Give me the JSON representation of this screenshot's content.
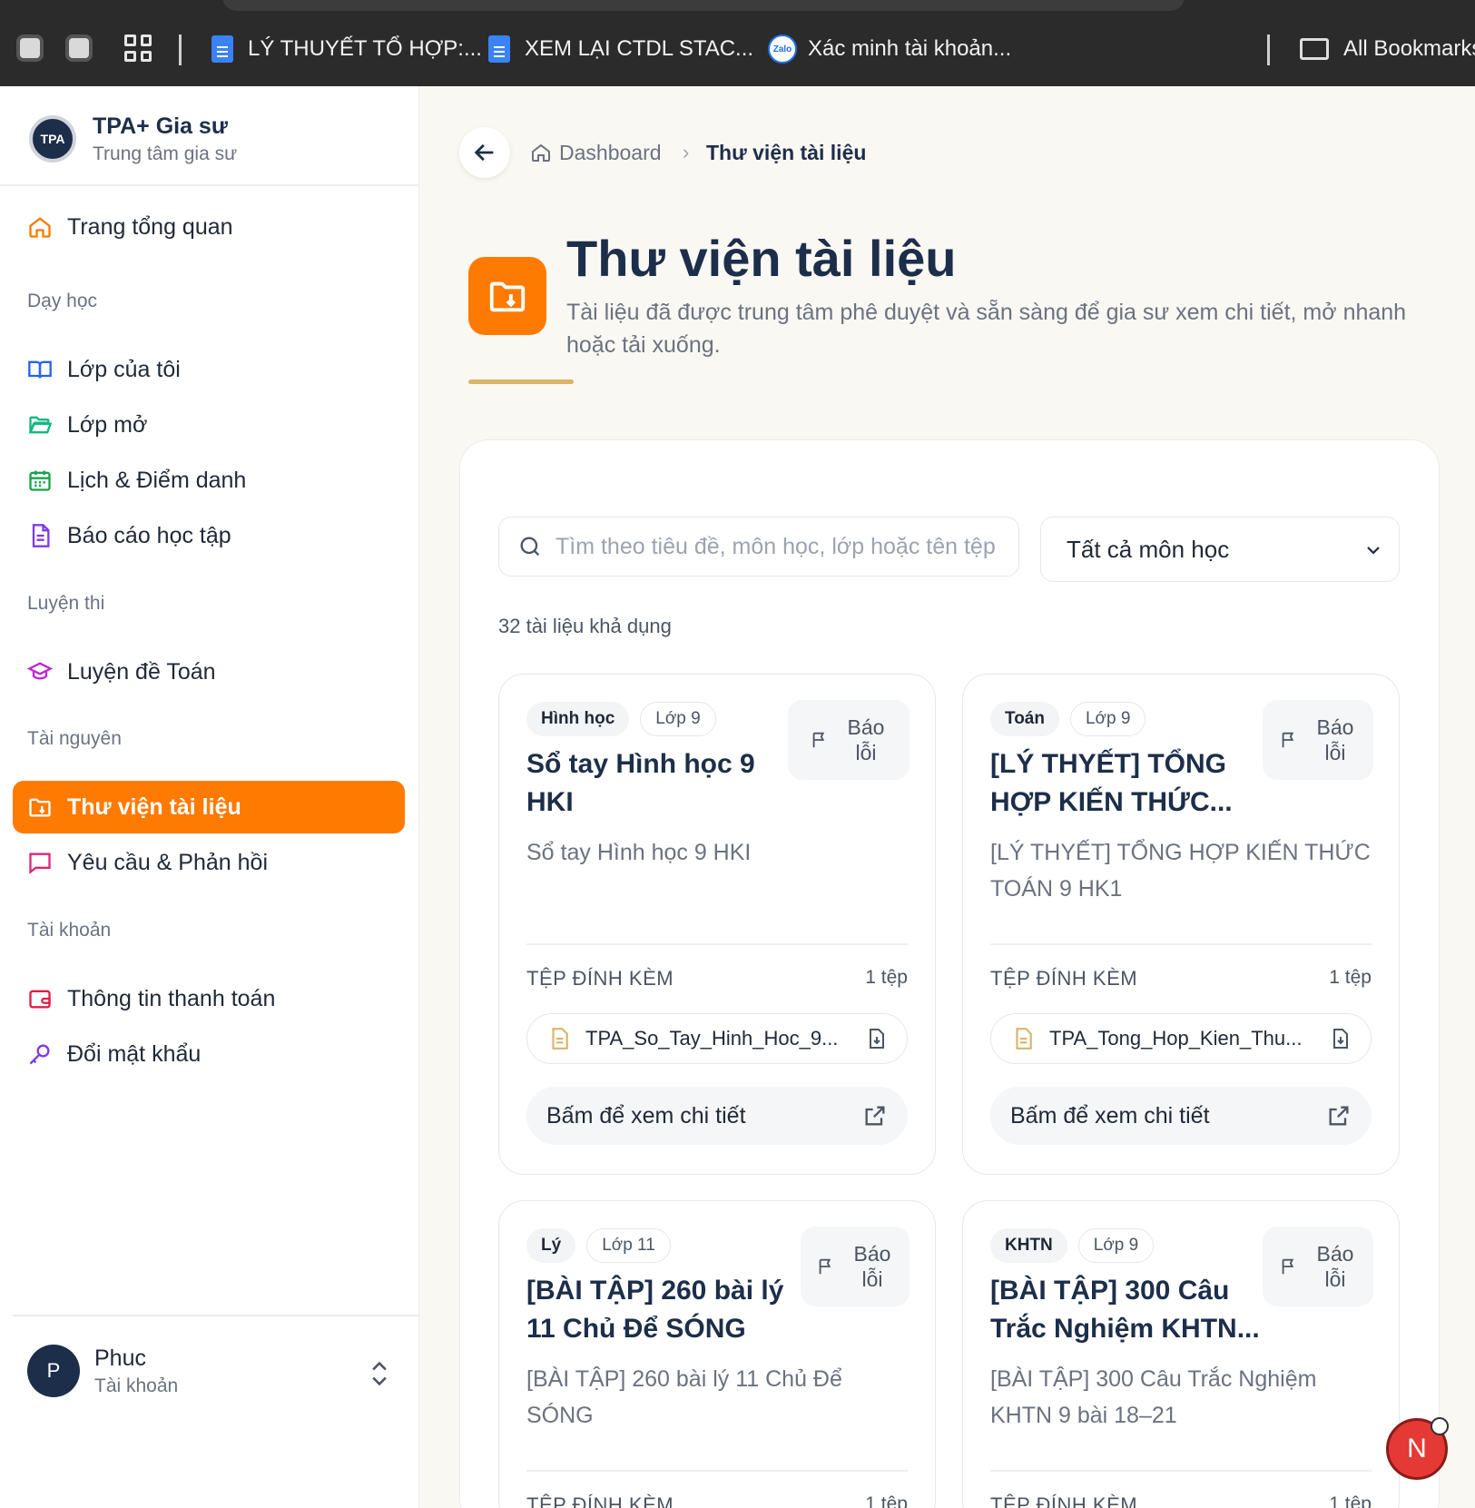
{
  "browser": {
    "bookmarks": [
      {
        "label": "LÝ THUYẾT TỔ HỢP:...",
        "icon": "google-docs-icon"
      },
      {
        "label": "XEM LẠI CTDL STAC...",
        "icon": "google-docs-icon"
      },
      {
        "label": "Xác minh tài khoản...",
        "icon": "zalo-icon"
      }
    ],
    "all_bookmarks": "All Bookmarks",
    "zalo_text": "Zalo"
  },
  "brand": {
    "logo_text": "TPA",
    "title": "TPA+ Gia sư",
    "subtitle": "Trung tâm gia sư"
  },
  "sidebar": {
    "overview": "Trang tổng quan",
    "sections": {
      "teaching": "Dạy học",
      "exam": "Luyện thi",
      "resources": "Tài nguyên",
      "account": "Tài khoản"
    },
    "teaching_items": [
      "Lớp của tôi",
      "Lớp mở",
      "Lịch & Điểm danh",
      "Báo cáo học tập"
    ],
    "exam_items": [
      "Luyện đề Toán"
    ],
    "resource_items": [
      "Thư viện tài liệu",
      "Yêu cầu & Phản hồi"
    ],
    "account_items": [
      "Thông tin thanh toán",
      "Đổi mật khẩu"
    ],
    "active": "Thư viện tài liệu"
  },
  "user": {
    "initial": "P",
    "name": "Phuc",
    "role": "Tài khoản"
  },
  "breadcrumb": {
    "home": "Dashboard",
    "separator": "›",
    "current": "Thư viện tài liệu"
  },
  "hero": {
    "title": "Thư viện tài liệu",
    "description": "Tài liệu đã được trung tâm phê duyệt và sẵn sàng để gia sư xem chi tiết, mở nhanh hoặc tải xuống."
  },
  "filters": {
    "search_placeholder": "Tìm theo tiêu đề, môn học, lớp hoặc tên tệp",
    "subject_selected": "Tất cả môn học"
  },
  "count_text": "32 tài liệu khả dụng",
  "labels": {
    "report": "Báo lỗi",
    "attachments": "TỆP ĐÍNH KÈM",
    "view_detail": "Bấm để xem chi tiết"
  },
  "cards": [
    {
      "subject": "Hình học",
      "grade": "Lớp 9",
      "title": "Sổ tay Hình học 9 HKI",
      "description": "Sổ tay Hình học 9 HKI",
      "file_count": "1 tệp",
      "file_name": "TPA_So_Tay_Hinh_Hoc_9..."
    },
    {
      "subject": "Toán",
      "grade": "Lớp 9",
      "title": "[LÝ THYẾT] TỔNG HỢP KIẾN THỨC...",
      "description": "[LÝ THYẾT] TỔNG HỢP KIẾN THỨC TOÁN 9 HK1",
      "file_count": "1 tệp",
      "file_name": "TPA_Tong_Hop_Kien_Thu..."
    },
    {
      "subject": "Lý",
      "grade": "Lớp 11",
      "title": "[BÀI TẬP] 260 bài lý 11 Chủ Để SÓNG",
      "description": "[BÀI TẬP] 260 bài lý 11 Chủ Để SÓNG",
      "file_count": "1 tệp",
      "file_name": ""
    },
    {
      "subject": "KHTN",
      "grade": "Lớp 9",
      "title": "[BÀI TẬP] 300 Câu Trắc Nghiệm KHTN...",
      "description": "[BÀI TẬP] 300 Câu Trắc Nghiệm KHTN 9 bài 18–21",
      "file_count": "1 tệp",
      "file_name": ""
    }
  ],
  "floating": {
    "initial": "N"
  },
  "colors": {
    "accent": "#ff7a00",
    "navy": "#1c2e4a",
    "gold": "#d9b46a"
  }
}
